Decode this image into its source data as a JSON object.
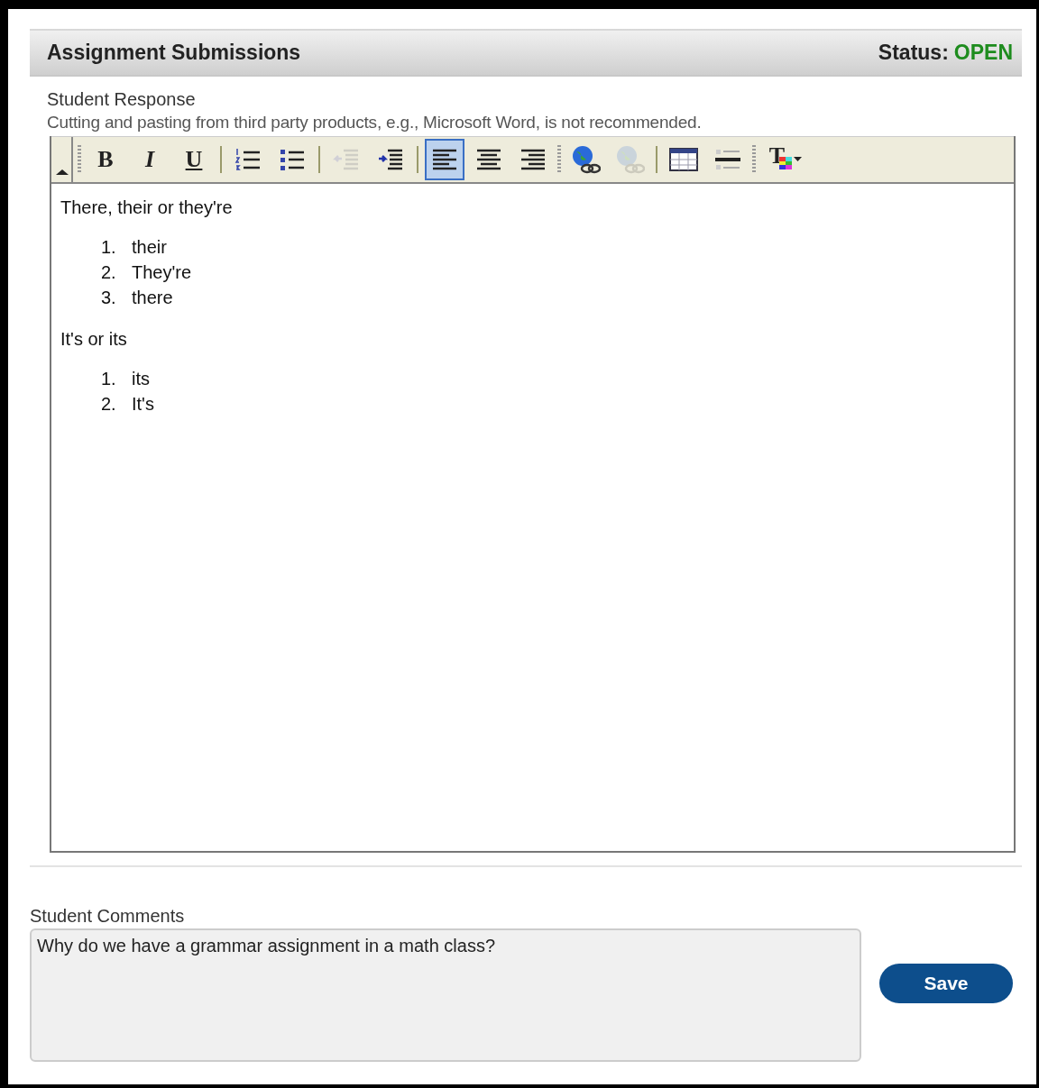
{
  "header": {
    "title": "Assignment Submissions",
    "status_label": "Status:",
    "status_value": "OPEN"
  },
  "response": {
    "label": "Student Response",
    "note": "Cutting and pasting from third party products, e.g., Microsoft Word, is not recommended."
  },
  "toolbar": [
    {
      "kind": "collapse"
    },
    {
      "kind": "grip"
    },
    {
      "kind": "bold",
      "label": "B",
      "selected": false,
      "disabled": false
    },
    {
      "kind": "italic",
      "label": "I",
      "selected": false,
      "disabled": false
    },
    {
      "kind": "underline",
      "label": "U",
      "selected": false,
      "disabled": false
    },
    {
      "kind": "sep"
    },
    {
      "kind": "numbered",
      "selected": false,
      "disabled": false
    },
    {
      "kind": "bulleted",
      "selected": false,
      "disabled": false
    },
    {
      "kind": "sep"
    },
    {
      "kind": "outdent",
      "selected": false,
      "disabled": true
    },
    {
      "kind": "indent",
      "selected": false,
      "disabled": false
    },
    {
      "kind": "sep"
    },
    {
      "kind": "align_left",
      "selected": true,
      "disabled": false
    },
    {
      "kind": "align_center",
      "selected": false,
      "disabled": false
    },
    {
      "kind": "align_right",
      "selected": false,
      "disabled": false
    },
    {
      "kind": "grip"
    },
    {
      "kind": "link",
      "selected": false,
      "disabled": false
    },
    {
      "kind": "unlink",
      "selected": false,
      "disabled": true
    },
    {
      "kind": "sep"
    },
    {
      "kind": "table",
      "selected": false,
      "disabled": false
    },
    {
      "kind": "rule",
      "selected": false,
      "disabled": false
    },
    {
      "kind": "grip"
    },
    {
      "kind": "text_color",
      "label": "T",
      "selected": false,
      "disabled": false
    }
  ],
  "content": [
    {
      "kind": "paragraph",
      "text": "There, their or they're"
    },
    {
      "kind": "list",
      "items": [
        {
          "number": "1.",
          "text": "their"
        },
        {
          "number": "2.",
          "text": "They're"
        },
        {
          "number": "3.",
          "text": "there"
        }
      ]
    },
    {
      "kind": "paragraph",
      "text": "It's or its"
    },
    {
      "kind": "list",
      "items": [
        {
          "number": "1.",
          "text": "its"
        },
        {
          "number": "2.",
          "text": "It's"
        }
      ]
    }
  ],
  "comments": {
    "label": "Student Comments",
    "value": "Why do we have a grammar assignment in a math class?"
  },
  "save_button": "Save"
}
